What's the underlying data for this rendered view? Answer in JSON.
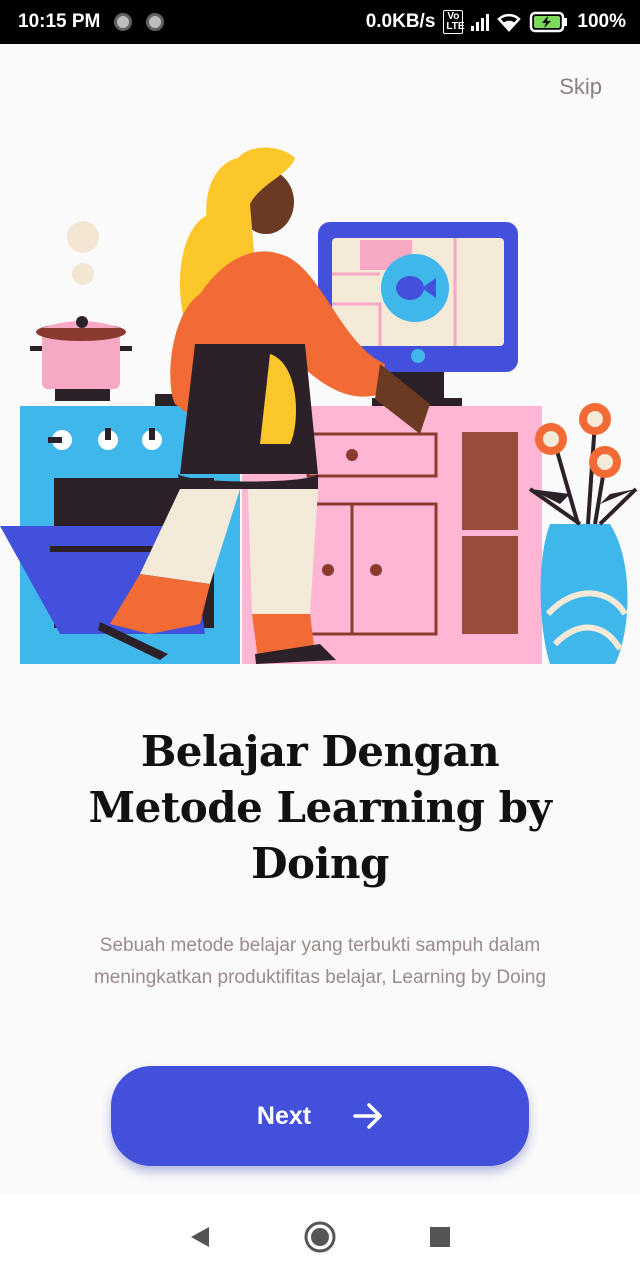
{
  "status_bar": {
    "time": "10:15 PM",
    "network_speed": "0.0KB/s",
    "volte": "Vo LTE",
    "battery": "100%"
  },
  "onboarding": {
    "skip_label": "Skip",
    "title": "Belajar Dengan Metode Learning by Doing",
    "description": "Sebuah metode belajar yang terbukti sampuh dalam meningkatkan produktifitas belajar, Learning by Doing",
    "next_label": "Next"
  },
  "icons": {
    "illustration": "woman-cooking-illustration",
    "next": "arrow-right-icon",
    "back": "back-triangle-icon",
    "home": "home-circle-icon",
    "recents": "recents-square-icon"
  },
  "colors": {
    "accent": "#4350dc",
    "text_title": "#111111",
    "text_body": "#9a8a8a",
    "skip": "#8d7f7f"
  }
}
